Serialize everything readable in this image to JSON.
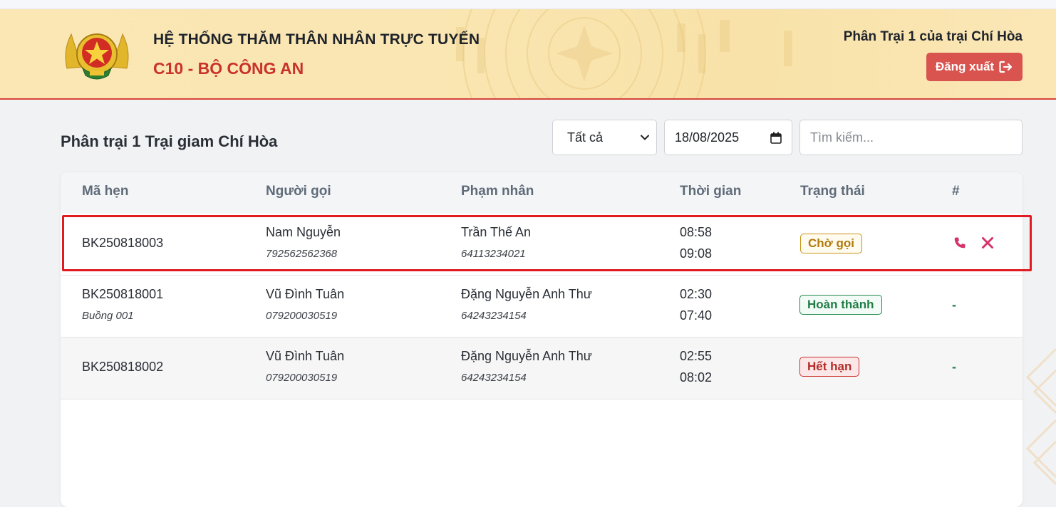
{
  "header": {
    "system_title": "HỆ THỐNG THĂM THÂN NHÂN TRỰC TUYẾN",
    "system_subtitle": "C10 - BỘ CÔNG AN",
    "user_name": "Phân Trại 1 của trại Chí Hòa",
    "logout_label": "Đăng xuất"
  },
  "page": {
    "title": "Phân trại 1 Trại giam Chí Hòa"
  },
  "filters": {
    "status_selected": "Tất cả",
    "date_value": "18/08/2025",
    "search_placeholder": "Tìm kiếm..."
  },
  "table": {
    "columns": [
      "Mã hẹn",
      "Người gọi",
      "Phạm nhân",
      "Thời gian",
      "Trạng thái",
      "#"
    ],
    "rows": [
      {
        "code": "BK250818003",
        "room": "",
        "caller_name": "Nam Nguyễn",
        "caller_id": "792562562368",
        "inmate_name": "Trần Thế An",
        "inmate_id": "64113234021",
        "time_start": "08:58",
        "time_end": "09:08",
        "status": "Chờ gọi",
        "action": ""
      },
      {
        "code": "BK250818001",
        "room": "Buồng 001",
        "caller_name": "Vũ Đình Tuân",
        "caller_id": "079200030519",
        "inmate_name": "Đặng Nguyễn Anh Thư",
        "inmate_id": "64243234154",
        "time_start": "02:30",
        "time_end": "07:40",
        "status": "Hoàn thành",
        "action": "-"
      },
      {
        "code": "BK250818002",
        "room": "",
        "caller_name": "Vũ Đình Tuân",
        "caller_id": "079200030519",
        "inmate_name": "Đặng Nguyễn Anh Thư",
        "inmate_id": "64243234154",
        "time_start": "02:55",
        "time_end": "08:02",
        "status": "Hết hạn",
        "action": "-"
      }
    ]
  },
  "icons": {
    "logo": "police-emblem-icon",
    "logout": "sign-out-icon",
    "call": "phone-icon",
    "cancel": "close-icon",
    "select": "chevron-down-icon",
    "date": "calendar-icon"
  },
  "colors": {
    "header_bg": "#fbe7b4",
    "accent_red": "#d9534f",
    "title_red": "#c8322b",
    "status_waiting": "#b07a0c",
    "status_done": "#1f7d45",
    "status_expired": "#b32b27",
    "call_icon": "#d6336c",
    "highlight": "#e11b22"
  }
}
